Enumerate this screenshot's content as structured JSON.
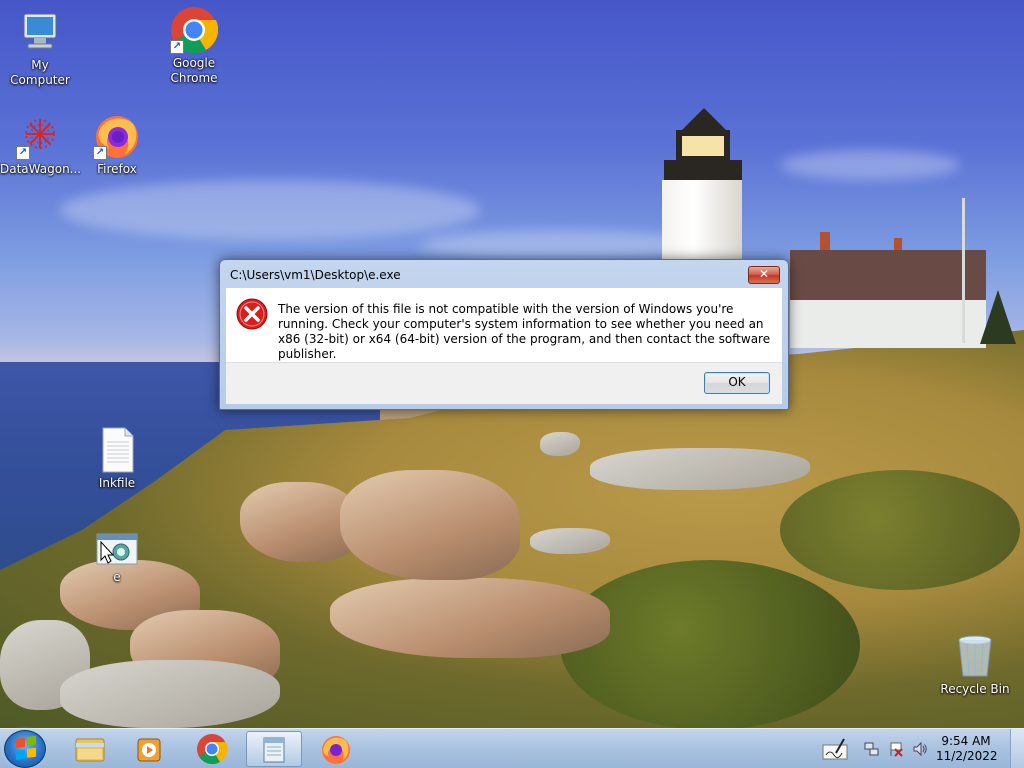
{
  "desktop": {
    "icons": [
      {
        "label": "My Computer",
        "icon": "computer-icon"
      },
      {
        "label": "Google Chrome",
        "icon": "chrome-icon"
      },
      {
        "label": "DataWagon...",
        "icon": "datawagon-icon"
      },
      {
        "label": "Firefox",
        "icon": "firefox-icon"
      },
      {
        "label": "Inkfile",
        "icon": "text-file-icon"
      },
      {
        "label": "e",
        "icon": "exe-file-icon"
      },
      {
        "label": "Recycle Bin",
        "icon": "recycle-bin-icon"
      }
    ]
  },
  "dialog": {
    "title": "C:\\Users\\vm1\\Desktop\\e.exe",
    "close_label": "✕",
    "message": "The version of this file is not compatible with the version of Windows you're running. Check your computer's system information to see whether you need an x86 (32-bit) or x64 (64-bit) version of the program, and then contact the software publisher.",
    "ok_label": "OK",
    "icon": "error-icon"
  },
  "taskbar": {
    "items": [
      {
        "name": "start-button",
        "icon": "windows-logo-icon"
      },
      {
        "name": "explorer",
        "icon": "folder-icon"
      },
      {
        "name": "media-player",
        "icon": "media-player-icon"
      },
      {
        "name": "chrome",
        "icon": "chrome-icon"
      },
      {
        "name": "notepad",
        "icon": "notepad-icon",
        "active": true
      },
      {
        "name": "firefox",
        "icon": "firefox-icon"
      }
    ],
    "tray_icons": [
      "handwriting-icon",
      "network-icon",
      "action-center-icon",
      "volume-icon"
    ],
    "clock": {
      "time": "9:54 AM",
      "date": "11/2/2022"
    }
  },
  "colors": {
    "taskbar": "#a9c2e0",
    "close_button": "#c0392b",
    "error_red": "#d81e1e",
    "ok_border": "#3c7fb1"
  }
}
